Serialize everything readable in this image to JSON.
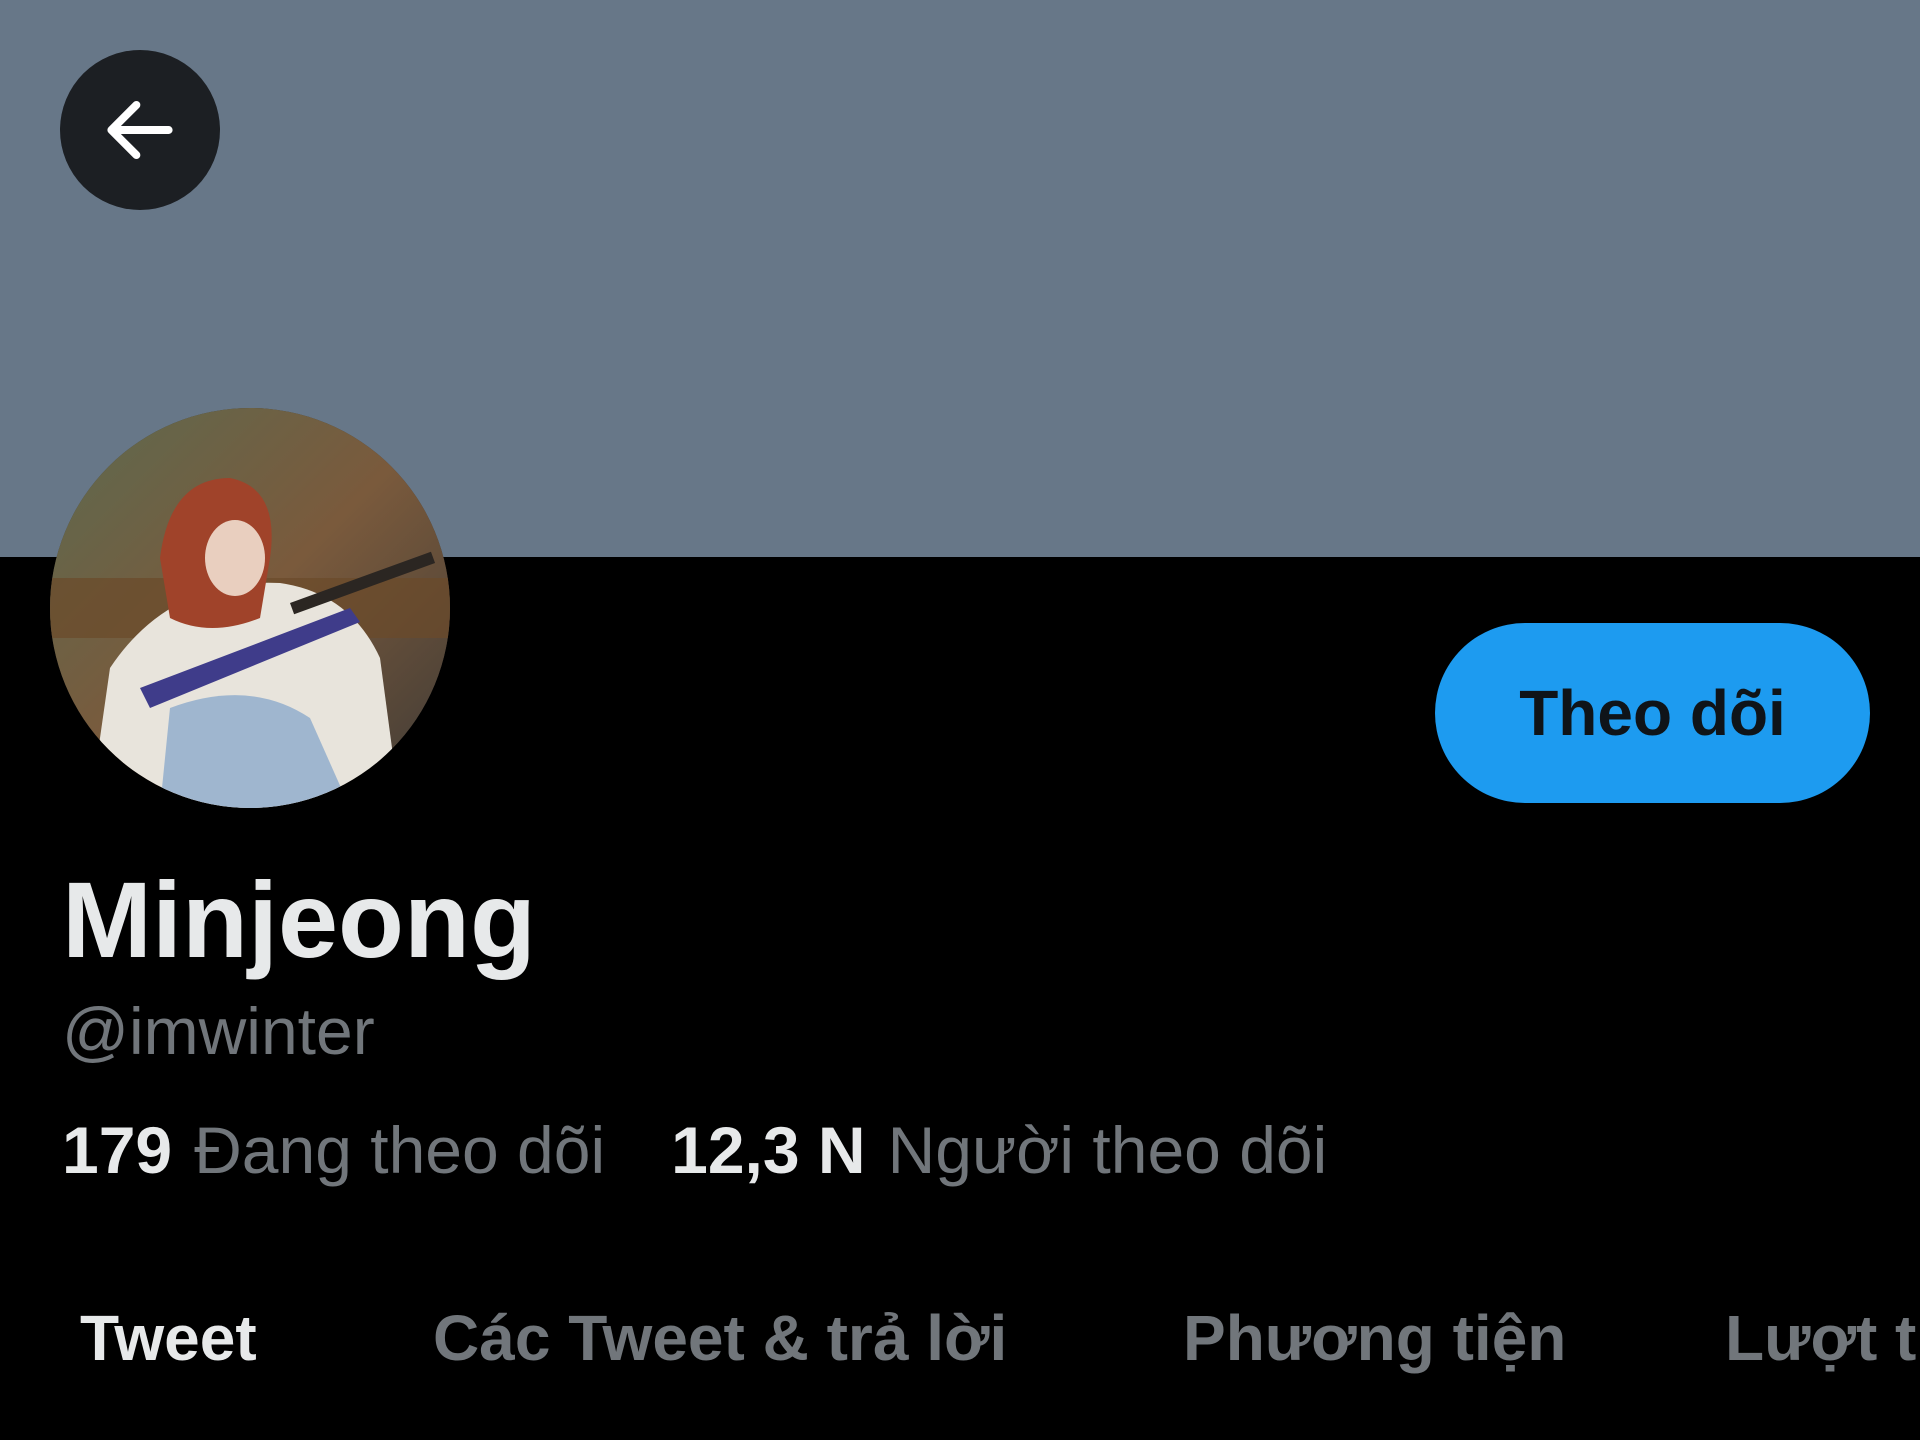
{
  "header": {
    "back_icon": "arrow-left-icon",
    "banner_color": "#677788"
  },
  "profile": {
    "display_name": "Minjeong",
    "handle": "@imwinter",
    "follow_label": "Theo dõi",
    "follow_color": "#1d9bf0"
  },
  "stats": {
    "following_count": "179",
    "following_label": "Đang theo dõi",
    "followers_count": "12,3 N",
    "followers_label": "Người theo dõi"
  },
  "tabs": [
    {
      "label": "Tweet",
      "active": true
    },
    {
      "label": "Các Tweet & trả lời",
      "active": false
    },
    {
      "label": "Phương tiện",
      "active": false
    },
    {
      "label": "Lượt th",
      "active": false
    }
  ]
}
